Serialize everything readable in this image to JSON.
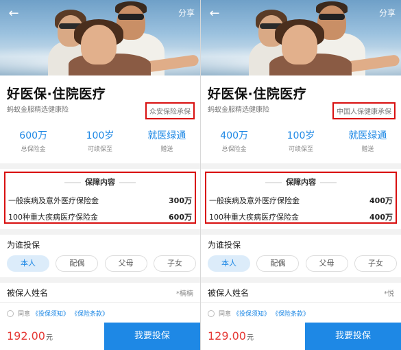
{
  "panels": [
    {
      "share": "分享",
      "title": "好医保·住院医疗",
      "subtitle": "蚂蚁金服精选健康险",
      "underwriter": "众安保险承保",
      "stats": [
        {
          "value": "600万",
          "label": "总保险金"
        },
        {
          "value": "100岁",
          "label": "可续保至"
        },
        {
          "value": "就医绿通",
          "label": "赠送"
        }
      ],
      "coverage_title": "保障内容",
      "coverage_rows": [
        {
          "name": "一般疾病及意外医疗保险金",
          "amount": "300万"
        },
        {
          "name": "100种重大疾病医疗保险金",
          "amount": "600万"
        }
      ],
      "who_label": "为谁投保",
      "who_tabs": [
        "本人",
        "配偶",
        "父母",
        "子女"
      ],
      "name_label": "被保人姓名",
      "name_value": "*楠楠",
      "agree_prefix": "同意",
      "agree_link1": "《投保须知》",
      "agree_link2": "《保险条款》",
      "price": "192.00",
      "price_unit": "元",
      "buy_label": "我要投保"
    },
    {
      "share": "分享",
      "title": "好医保·住院医疗",
      "subtitle": "蚂蚁金服精选健康险",
      "underwriter": "中国人保健康承保",
      "stats": [
        {
          "value": "400万",
          "label": "总保险金"
        },
        {
          "value": "100岁",
          "label": "可续保至"
        },
        {
          "value": "就医绿通",
          "label": "赠送"
        }
      ],
      "coverage_title": "保障内容",
      "coverage_rows": [
        {
          "name": "一般疾病及意外医疗保险金",
          "amount": "400万"
        },
        {
          "name": "100种重大疾病医疗保险金",
          "amount": "400万"
        }
      ],
      "who_label": "为谁投保",
      "who_tabs": [
        "本人",
        "配偶",
        "父母",
        "子女"
      ],
      "name_label": "被保人姓名",
      "name_value": "*悦",
      "agree_prefix": "同意",
      "agree_link1": "《投保须知》",
      "agree_link2": "《保险条款》",
      "price": "129.00",
      "price_unit": "元",
      "buy_label": "我要投保"
    }
  ],
  "colors": {
    "accent": "#1e88e5",
    "highlight_box": "#d80f0f",
    "price": "#e53935"
  },
  "icons": {
    "back": "arrow-left",
    "share": "text"
  }
}
